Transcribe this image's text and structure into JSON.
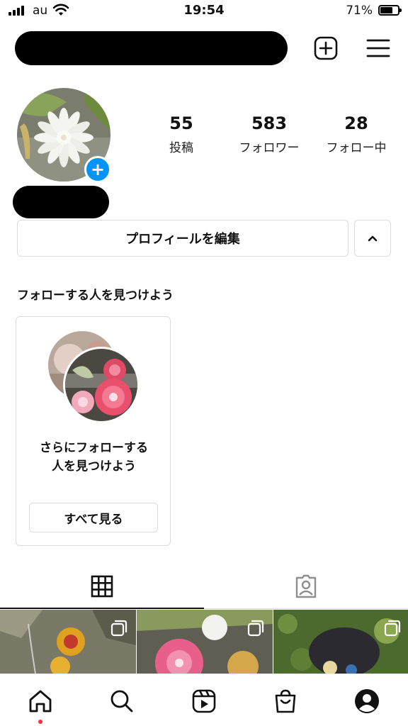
{
  "status_bar": {
    "carrier": "au",
    "time": "19:54",
    "battery_percent": "71%",
    "battery_level": 0.71
  },
  "header": {
    "username_redacted": true,
    "icons": [
      "plus-square-icon",
      "menu-icon"
    ]
  },
  "profile": {
    "stats": [
      {
        "value": "55",
        "label": "投稿"
      },
      {
        "value": "583",
        "label": "フォロワー"
      },
      {
        "value": "28",
        "label": "フォロー中"
      }
    ],
    "add_badge": "+",
    "edit_profile_label": "プロフィールを編集"
  },
  "discover": {
    "title": "フォローする人を見つけよう",
    "card_text_line1": "さらにフォローする",
    "card_text_line2": "人を見つけよう",
    "see_all_label": "すべて見る"
  },
  "tabs": [
    "grid-icon",
    "tagged-icon"
  ],
  "nav": [
    "home-icon",
    "search-icon",
    "reels-icon",
    "shop-icon",
    "profile-icon"
  ],
  "colors": {
    "accent": "#0095f6",
    "border": "#dbdbdb",
    "notification_dot": "#ff3040"
  }
}
